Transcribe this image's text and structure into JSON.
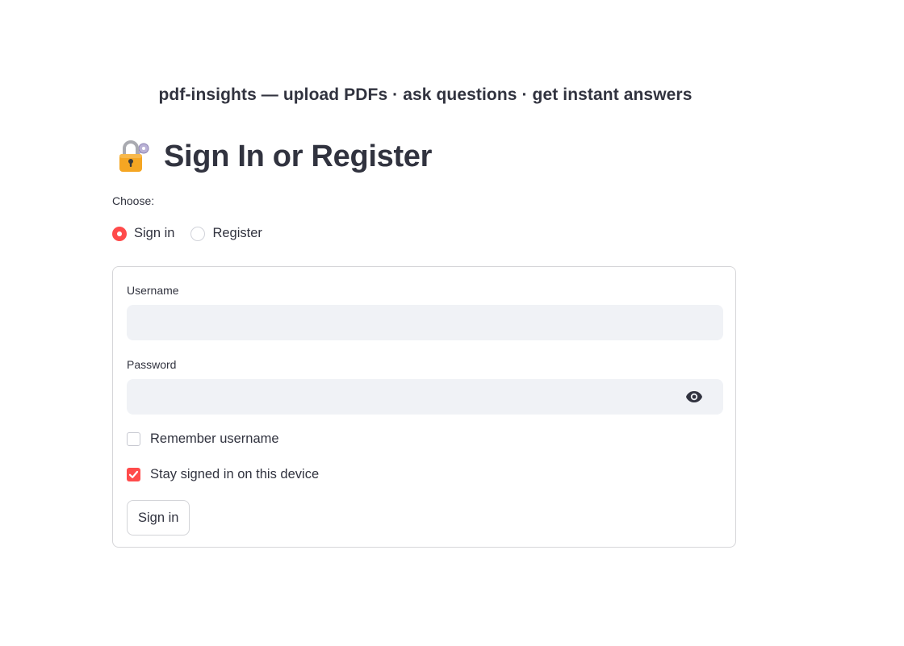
{
  "header": {
    "tagline": "pdf-insights — upload PDFs · ask questions · get instant answers"
  },
  "title": {
    "icon": "lock-with-key-icon",
    "text": "Sign In or Register"
  },
  "mode_selector": {
    "label": "Choose:",
    "options": [
      {
        "label": "Sign in",
        "selected": true
      },
      {
        "label": "Register",
        "selected": false
      }
    ]
  },
  "form": {
    "username": {
      "label": "Username",
      "value": "",
      "placeholder": ""
    },
    "password": {
      "label": "Password",
      "value": "",
      "placeholder": "",
      "toggle_icon": "eye-icon"
    },
    "remember_username": {
      "label": "Remember username",
      "checked": false
    },
    "stay_signed_in": {
      "label": "Stay signed in on this device",
      "checked": true
    },
    "submit_label": "Sign in"
  },
  "colors": {
    "accent": "#ff4b4b",
    "text": "#31333f",
    "input_bg": "#f0f2f6",
    "border": "#d6d6d9"
  }
}
